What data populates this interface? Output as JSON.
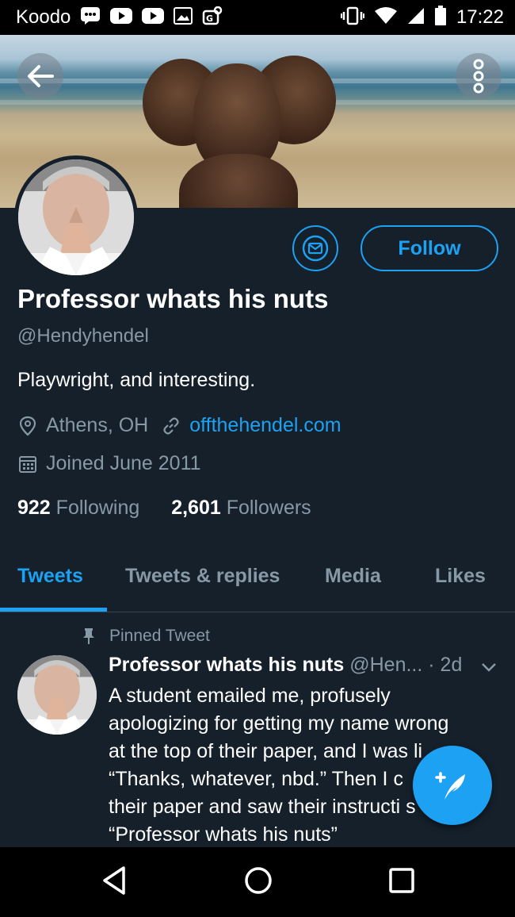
{
  "status_bar": {
    "carrier": "Koodo",
    "time": "17:22",
    "icons": [
      "message-icon",
      "youtube-icon",
      "youtube-icon",
      "gallery-icon",
      "vpn-key-icon",
      "vibrate-icon",
      "wifi-icon",
      "signal-icon",
      "battery-icon"
    ]
  },
  "profile": {
    "name": "Professor whats his nuts",
    "handle": "@Hendyhendel",
    "bio": "Playwright, and interesting.",
    "location": "Athens, OH",
    "website": "offthehendel.com",
    "joined": "Joined June 2011",
    "following_count": "922",
    "following_label": "Following",
    "followers_count": "2,601",
    "followers_label": "Followers",
    "follow_button": "Follow"
  },
  "tabs": [
    {
      "label": "Tweets",
      "active": true
    },
    {
      "label": "Tweets & replies",
      "active": false
    },
    {
      "label": "Media",
      "active": false
    },
    {
      "label": "Likes",
      "active": false
    }
  ],
  "pinned_tweet": {
    "pinned_label": "Pinned Tweet",
    "author_name": "Professor whats his nuts",
    "author_handle": "@Hen...",
    "time": "· 2d",
    "lines": [
      "A student emailed me, profusely",
      "apologizing for getting my name wrong",
      "at the top of their paper, and I was li",
      "“Thanks, whatever, nbd.” Then I c",
      "their paper and saw their instructi     s",
      "“Professor whats his nuts”"
    ]
  },
  "colors": {
    "background": "#15202b",
    "accent": "#1da1f2",
    "secondary_text": "#8899a6",
    "divider": "#38444d"
  }
}
